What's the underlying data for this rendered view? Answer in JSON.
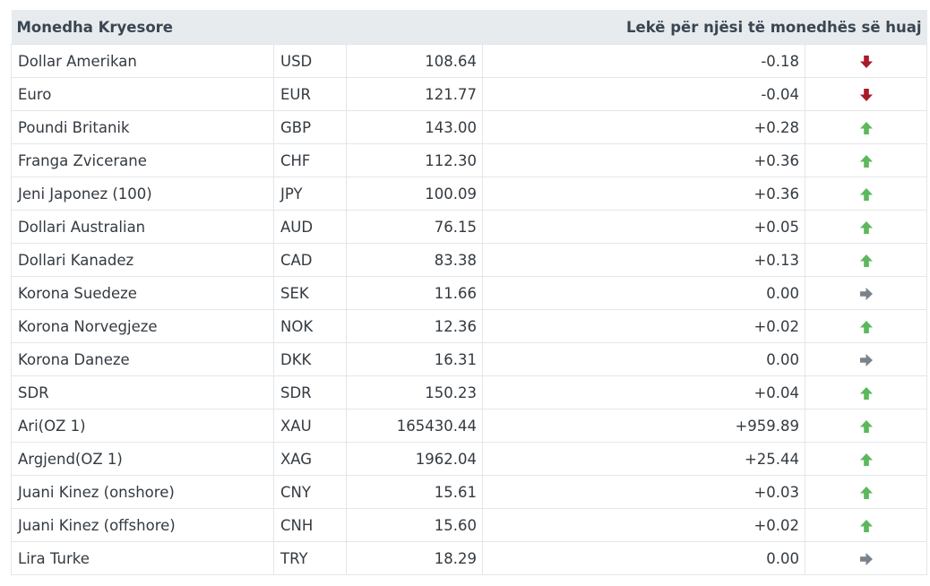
{
  "table": {
    "header_left": "Monedha Kryesore",
    "header_right": "Lekë për njësi të monedhës së huaj",
    "colors": {
      "up": "#5cb85c",
      "down": "#a91b2b",
      "flat": "#7a838c"
    },
    "rows": [
      {
        "name": "Dollar Amerikan",
        "code": "USD",
        "rate": "108.64",
        "change": "-0.18",
        "trend": "down",
        "icon": "arrow-down-icon"
      },
      {
        "name": "Euro",
        "code": "EUR",
        "rate": "121.77",
        "change": "-0.04",
        "trend": "down",
        "icon": "arrow-down-icon"
      },
      {
        "name": "Poundi Britanik",
        "code": "GBP",
        "rate": "143.00",
        "change": "+0.28",
        "trend": "up",
        "icon": "arrow-up-icon"
      },
      {
        "name": "Franga Zvicerane",
        "code": "CHF",
        "rate": "112.30",
        "change": "+0.36",
        "trend": "up",
        "icon": "arrow-up-icon"
      },
      {
        "name": "Jeni Japonez (100)",
        "code": "JPY",
        "rate": "100.09",
        "change": "+0.36",
        "trend": "up",
        "icon": "arrow-up-icon"
      },
      {
        "name": "Dollari Australian",
        "code": "AUD",
        "rate": "76.15",
        "change": "+0.05",
        "trend": "up",
        "icon": "arrow-up-icon"
      },
      {
        "name": "Dollari Kanadez",
        "code": "CAD",
        "rate": "83.38",
        "change": "+0.13",
        "trend": "up",
        "icon": "arrow-up-icon"
      },
      {
        "name": "Korona Suedeze",
        "code": "SEK",
        "rate": "11.66",
        "change": "0.00",
        "trend": "flat",
        "icon": "arrow-right-icon"
      },
      {
        "name": "Korona Norvegjeze",
        "code": "NOK",
        "rate": "12.36",
        "change": "+0.02",
        "trend": "up",
        "icon": "arrow-up-icon"
      },
      {
        "name": "Korona Daneze",
        "code": "DKK",
        "rate": "16.31",
        "change": "0.00",
        "trend": "flat",
        "icon": "arrow-right-icon"
      },
      {
        "name": "SDR",
        "code": "SDR",
        "rate": "150.23",
        "change": "+0.04",
        "trend": "up",
        "icon": "arrow-up-icon"
      },
      {
        "name": "Ari(OZ 1)",
        "code": "XAU",
        "rate": "165430.44",
        "change": "+959.89",
        "trend": "up",
        "icon": "arrow-up-icon"
      },
      {
        "name": "Argjend(OZ 1)",
        "code": "XAG",
        "rate": "1962.04",
        "change": "+25.44",
        "trend": "up",
        "icon": "arrow-up-icon"
      },
      {
        "name": "Juani Kinez (onshore)",
        "code": "CNY",
        "rate": "15.61",
        "change": "+0.03",
        "trend": "up",
        "icon": "arrow-up-icon"
      },
      {
        "name": "Juani Kinez (offshore)",
        "code": "CNH",
        "rate": "15.60",
        "change": "+0.02",
        "trend": "up",
        "icon": "arrow-up-icon"
      },
      {
        "name": "Lira Turke",
        "code": "TRY",
        "rate": "18.29",
        "change": "0.00",
        "trend": "flat",
        "icon": "arrow-right-icon"
      }
    ]
  }
}
